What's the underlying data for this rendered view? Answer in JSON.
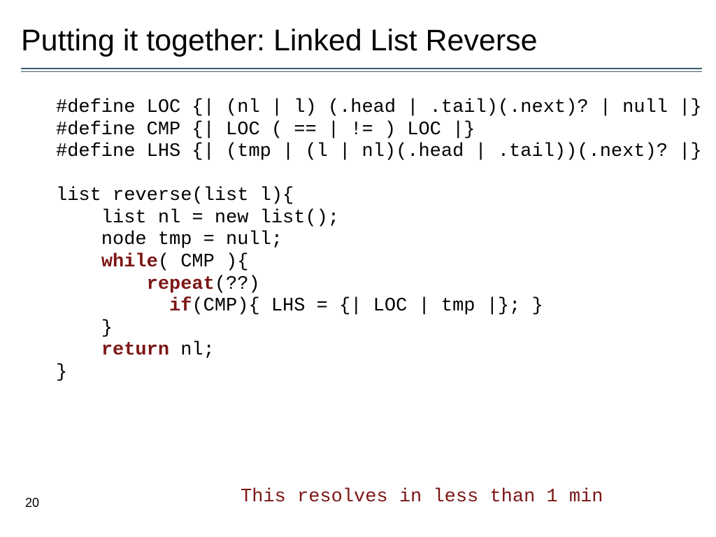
{
  "title": "Putting it together: Linked List Reverse",
  "code": {
    "l1": "#define LOC {| (nl | l) (.head | .tail)(.next)? | null |}",
    "l2": "#define CMP {| LOC ( == | != ) LOC |}",
    "l3": "#define LHS {| (tmp | (l | nl)(.head | .tail))(.next)? |}",
    "l5": "list reverse(list l){",
    "l6": "    list nl = new list();",
    "l7": "    node tmp = null;",
    "l8a": "    ",
    "l8_kw": "while",
    "l8b": "( CMP ){",
    "l9a": "        ",
    "l9_kw": "repeat",
    "l9b": "(??)",
    "l10a": "          ",
    "l10_kw": "if",
    "l10b": "(CMP){ LHS = {| LOC | tmp |}; }",
    "l11": "    }",
    "l12a": "    ",
    "l12_kw": "return",
    "l12b": " nl;",
    "l13": "}"
  },
  "footnote": "This resolves in less than 1 min",
  "page_number": "20"
}
